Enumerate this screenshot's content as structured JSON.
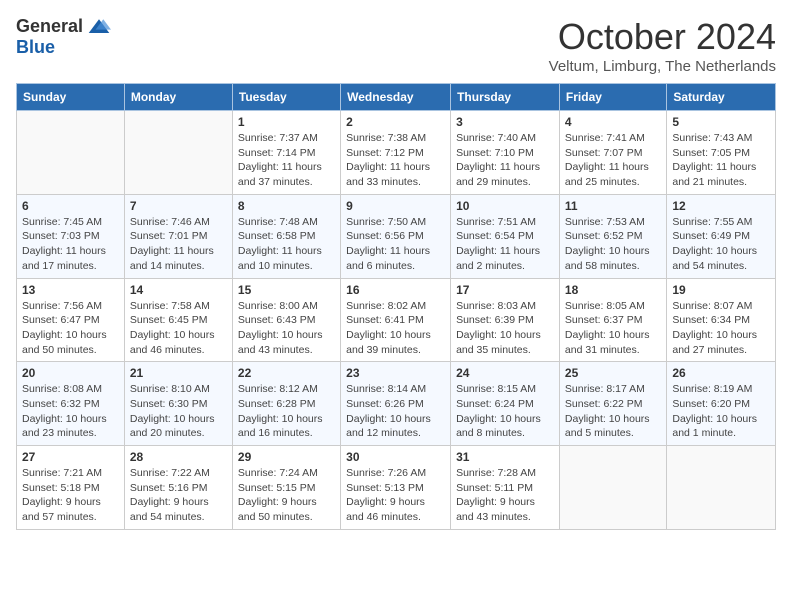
{
  "header": {
    "logo_general": "General",
    "logo_blue": "Blue",
    "month_title": "October 2024",
    "subtitle": "Veltum, Limburg, The Netherlands"
  },
  "weekdays": [
    "Sunday",
    "Monday",
    "Tuesday",
    "Wednesday",
    "Thursday",
    "Friday",
    "Saturday"
  ],
  "weeks": [
    [
      {
        "day": "",
        "info": ""
      },
      {
        "day": "",
        "info": ""
      },
      {
        "day": "1",
        "info": "Sunrise: 7:37 AM\nSunset: 7:14 PM\nDaylight: 11 hours and 37 minutes."
      },
      {
        "day": "2",
        "info": "Sunrise: 7:38 AM\nSunset: 7:12 PM\nDaylight: 11 hours and 33 minutes."
      },
      {
        "day": "3",
        "info": "Sunrise: 7:40 AM\nSunset: 7:10 PM\nDaylight: 11 hours and 29 minutes."
      },
      {
        "day": "4",
        "info": "Sunrise: 7:41 AM\nSunset: 7:07 PM\nDaylight: 11 hours and 25 minutes."
      },
      {
        "day": "5",
        "info": "Sunrise: 7:43 AM\nSunset: 7:05 PM\nDaylight: 11 hours and 21 minutes."
      }
    ],
    [
      {
        "day": "6",
        "info": "Sunrise: 7:45 AM\nSunset: 7:03 PM\nDaylight: 11 hours and 17 minutes."
      },
      {
        "day": "7",
        "info": "Sunrise: 7:46 AM\nSunset: 7:01 PM\nDaylight: 11 hours and 14 minutes."
      },
      {
        "day": "8",
        "info": "Sunrise: 7:48 AM\nSunset: 6:58 PM\nDaylight: 11 hours and 10 minutes."
      },
      {
        "day": "9",
        "info": "Sunrise: 7:50 AM\nSunset: 6:56 PM\nDaylight: 11 hours and 6 minutes."
      },
      {
        "day": "10",
        "info": "Sunrise: 7:51 AM\nSunset: 6:54 PM\nDaylight: 11 hours and 2 minutes."
      },
      {
        "day": "11",
        "info": "Sunrise: 7:53 AM\nSunset: 6:52 PM\nDaylight: 10 hours and 58 minutes."
      },
      {
        "day": "12",
        "info": "Sunrise: 7:55 AM\nSunset: 6:49 PM\nDaylight: 10 hours and 54 minutes."
      }
    ],
    [
      {
        "day": "13",
        "info": "Sunrise: 7:56 AM\nSunset: 6:47 PM\nDaylight: 10 hours and 50 minutes."
      },
      {
        "day": "14",
        "info": "Sunrise: 7:58 AM\nSunset: 6:45 PM\nDaylight: 10 hours and 46 minutes."
      },
      {
        "day": "15",
        "info": "Sunrise: 8:00 AM\nSunset: 6:43 PM\nDaylight: 10 hours and 43 minutes."
      },
      {
        "day": "16",
        "info": "Sunrise: 8:02 AM\nSunset: 6:41 PM\nDaylight: 10 hours and 39 minutes."
      },
      {
        "day": "17",
        "info": "Sunrise: 8:03 AM\nSunset: 6:39 PM\nDaylight: 10 hours and 35 minutes."
      },
      {
        "day": "18",
        "info": "Sunrise: 8:05 AM\nSunset: 6:37 PM\nDaylight: 10 hours and 31 minutes."
      },
      {
        "day": "19",
        "info": "Sunrise: 8:07 AM\nSunset: 6:34 PM\nDaylight: 10 hours and 27 minutes."
      }
    ],
    [
      {
        "day": "20",
        "info": "Sunrise: 8:08 AM\nSunset: 6:32 PM\nDaylight: 10 hours and 23 minutes."
      },
      {
        "day": "21",
        "info": "Sunrise: 8:10 AM\nSunset: 6:30 PM\nDaylight: 10 hours and 20 minutes."
      },
      {
        "day": "22",
        "info": "Sunrise: 8:12 AM\nSunset: 6:28 PM\nDaylight: 10 hours and 16 minutes."
      },
      {
        "day": "23",
        "info": "Sunrise: 8:14 AM\nSunset: 6:26 PM\nDaylight: 10 hours and 12 minutes."
      },
      {
        "day": "24",
        "info": "Sunrise: 8:15 AM\nSunset: 6:24 PM\nDaylight: 10 hours and 8 minutes."
      },
      {
        "day": "25",
        "info": "Sunrise: 8:17 AM\nSunset: 6:22 PM\nDaylight: 10 hours and 5 minutes."
      },
      {
        "day": "26",
        "info": "Sunrise: 8:19 AM\nSunset: 6:20 PM\nDaylight: 10 hours and 1 minute."
      }
    ],
    [
      {
        "day": "27",
        "info": "Sunrise: 7:21 AM\nSunset: 5:18 PM\nDaylight: 9 hours and 57 minutes."
      },
      {
        "day": "28",
        "info": "Sunrise: 7:22 AM\nSunset: 5:16 PM\nDaylight: 9 hours and 54 minutes."
      },
      {
        "day": "29",
        "info": "Sunrise: 7:24 AM\nSunset: 5:15 PM\nDaylight: 9 hours and 50 minutes."
      },
      {
        "day": "30",
        "info": "Sunrise: 7:26 AM\nSunset: 5:13 PM\nDaylight: 9 hours and 46 minutes."
      },
      {
        "day": "31",
        "info": "Sunrise: 7:28 AM\nSunset: 5:11 PM\nDaylight: 9 hours and 43 minutes."
      },
      {
        "day": "",
        "info": ""
      },
      {
        "day": "",
        "info": ""
      }
    ]
  ]
}
